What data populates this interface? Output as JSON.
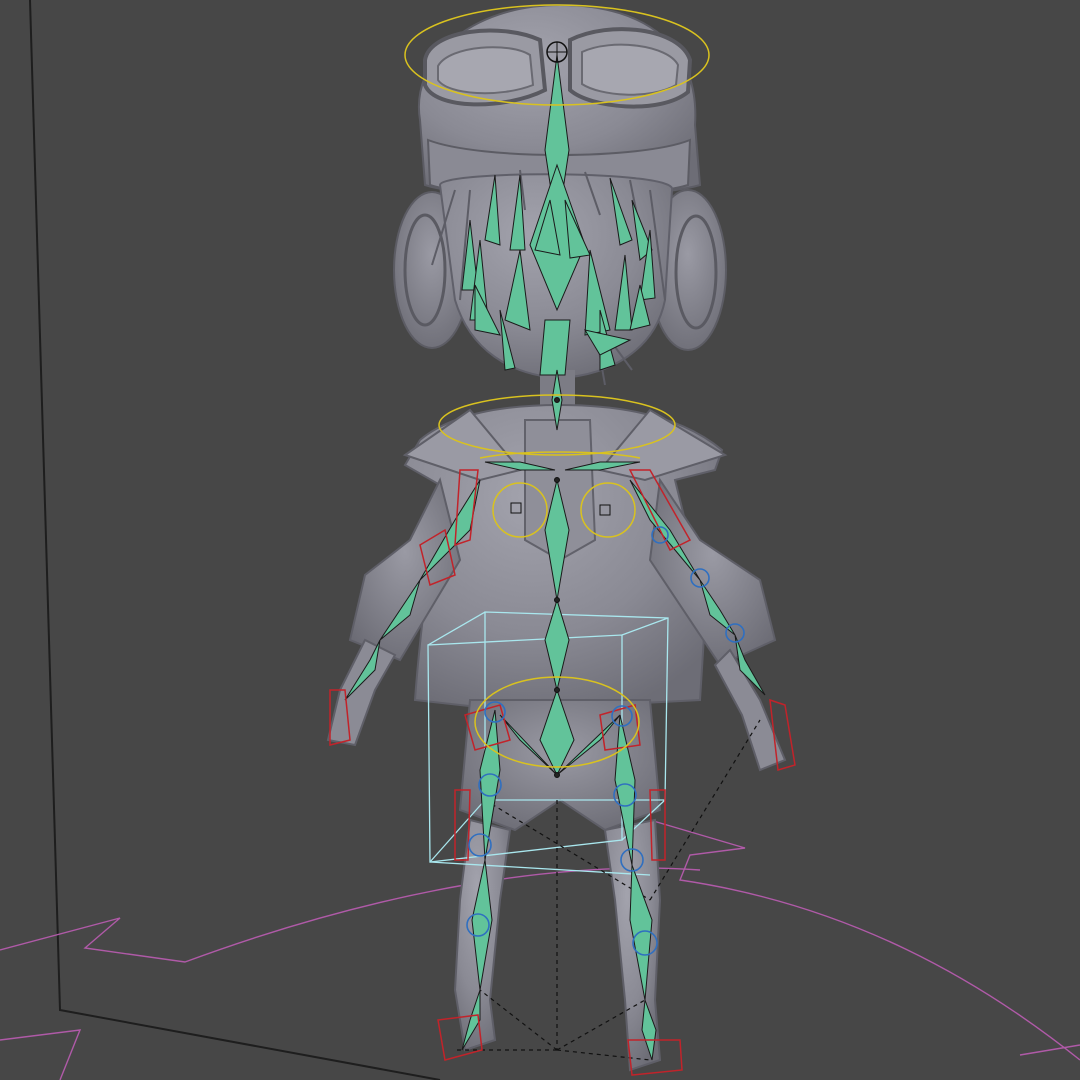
{
  "viewport": {
    "background": "#474747",
    "mesh_color": "#8d8d96",
    "bone_color": "#62c39a",
    "selection_color": "#d9c21f",
    "ik_color": "#c2232a",
    "pole_color": "#2f6fc0",
    "bbox_color": "#a9e7ee",
    "floor_curve_color": "#b05aa8"
  },
  "scene": {
    "icons": [
      "armature-icon",
      "mesh-icon",
      "bone-icon"
    ]
  }
}
